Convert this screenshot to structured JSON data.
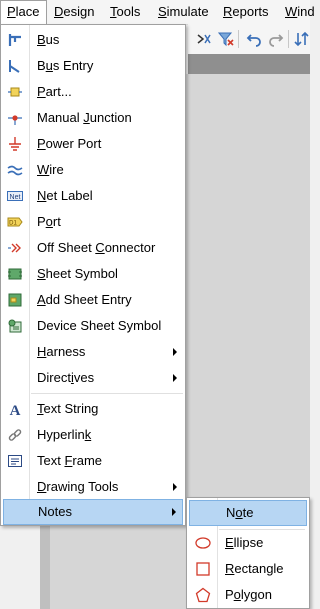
{
  "menubar": {
    "items": [
      {
        "label": "Place",
        "accel": "P",
        "rest": "lace"
      },
      {
        "label": "Design",
        "accel": "D",
        "rest": "esign"
      },
      {
        "label": "Tools",
        "accel": "T",
        "rest": "ools"
      },
      {
        "label": "Simulate",
        "accel": "S",
        "rest": "imulate"
      },
      {
        "label": "Reports",
        "accel": "R",
        "rest": "eports"
      },
      {
        "label": "Wind",
        "accel": "W",
        "rest": "ind"
      }
    ]
  },
  "place_menu": {
    "items": [
      {
        "pre": "",
        "accel": "B",
        "post": "us",
        "icon": "bus-icon"
      },
      {
        "pre": "B",
        "accel": "u",
        "post": "s Entry",
        "icon": "bus-entry-icon"
      },
      {
        "pre": "",
        "accel": "P",
        "post": "art...",
        "icon": "part-icon"
      },
      {
        "pre": "Manual ",
        "accel": "J",
        "post": "unction",
        "icon": "manual-junction-icon"
      },
      {
        "pre": "",
        "accel": "P",
        "post": "ower Port",
        "icon": "power-port-icon"
      },
      {
        "pre": "",
        "accel": "W",
        "post": "ire",
        "icon": "wire-icon"
      },
      {
        "pre": "",
        "accel": "N",
        "post": "et Label",
        "icon": "net-label-icon"
      },
      {
        "pre": "P",
        "accel": "o",
        "post": "rt",
        "icon": "port-icon"
      },
      {
        "pre": "Off Sheet ",
        "accel": "C",
        "post": "onnector",
        "icon": "off-sheet-connector-icon"
      },
      {
        "pre": "",
        "accel": "S",
        "post": "heet Symbol",
        "icon": "sheet-symbol-icon"
      },
      {
        "pre": "",
        "accel": "A",
        "post": "dd Sheet Entry",
        "icon": "add-sheet-entry-icon"
      },
      {
        "pre": "Device Sheet Symbol",
        "accel": "",
        "post": "",
        "icon": "device-sheet-symbol-icon"
      },
      {
        "pre": "",
        "accel": "H",
        "post": "arness",
        "icon": "",
        "submenu": true
      },
      {
        "pre": "Direct",
        "accel": "i",
        "post": "ves",
        "icon": "",
        "submenu": true
      },
      {
        "pre": "",
        "accel": "T",
        "post": "ext String",
        "icon": "text-string-icon"
      },
      {
        "pre": "Hyperlin",
        "accel": "k",
        "post": "",
        "icon": "hyperlink-icon"
      },
      {
        "pre": "Text ",
        "accel": "F",
        "post": "rame",
        "icon": "text-frame-icon"
      },
      {
        "pre": "",
        "accel": "D",
        "post": "rawing Tools",
        "icon": "",
        "submenu": true
      },
      {
        "pre": "Notes",
        "accel": "",
        "post": "",
        "icon": "",
        "submenu": true,
        "highlighted": true
      }
    ]
  },
  "notes_submenu": {
    "items": [
      {
        "pre": "N",
        "accel": "o",
        "post": "te",
        "icon": "",
        "highlighted": true
      },
      {
        "pre": "",
        "accel": "E",
        "post": "llipse",
        "icon": "ellipse-icon"
      },
      {
        "pre": "",
        "accel": "R",
        "post": "ectangle",
        "icon": "rectangle-icon"
      },
      {
        "pre": "P",
        "accel": "o",
        "post": "lygon",
        "icon": "polygon-icon"
      }
    ]
  },
  "colors": {
    "highlight": "#b7d6f3",
    "highlight_border": "#7fb2e3",
    "icon_blue": "#3a6fb8",
    "icon_red": "#d23a2a",
    "icon_yellow": "#e8c33a",
    "icon_green": "#3d9b4a"
  }
}
